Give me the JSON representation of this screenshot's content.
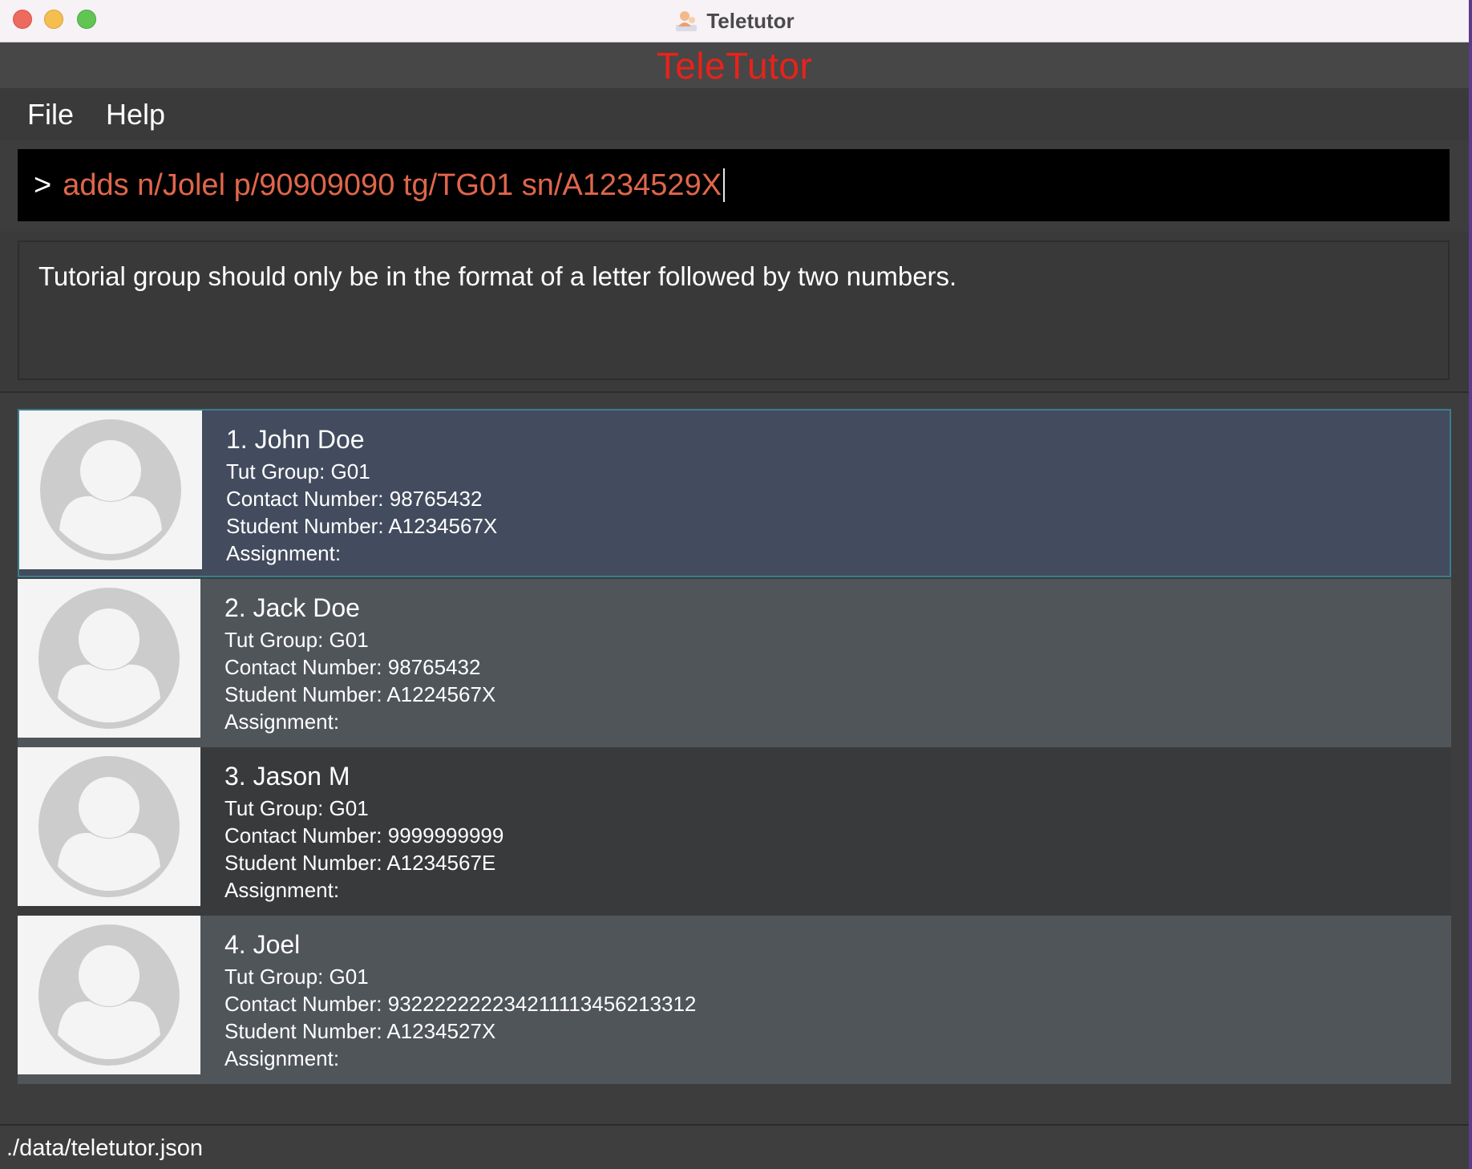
{
  "window": {
    "title": "Teletutor",
    "icon": "teletutor-app-icon"
  },
  "app": {
    "header_title": "TeleTutor",
    "header_color": "#e8221b"
  },
  "menu": {
    "items": [
      "File",
      "Help"
    ]
  },
  "command": {
    "prompt": ">",
    "value": "adds n/Jolel p/90909090 tg/TG01 sn/A1234529X",
    "text_color": "#e0664b"
  },
  "result": {
    "message": "Tutorial group should only be in the format of a letter followed by two numbers."
  },
  "persons": [
    {
      "name": "1. John Doe",
      "tut_group": "Tut Group: G01",
      "contact": "Contact Number: 98765432",
      "student_number": "Student Number: A1234567X",
      "assignment": "Assignment:",
      "selected": true
    },
    {
      "name": "2. Jack Doe",
      "tut_group": "Tut Group: G01",
      "contact": "Contact Number: 98765432",
      "student_number": "Student Number: A1224567X",
      "assignment": "Assignment:",
      "selected": false
    },
    {
      "name": "3. Jason M",
      "tut_group": "Tut Group: G01",
      "contact": "Contact Number: 9999999999",
      "student_number": "Student Number: A1234567E",
      "assignment": "Assignment:",
      "selected": false
    },
    {
      "name": "4. Joel",
      "tut_group": "Tut Group: G01",
      "contact": "Contact Number: 9322222222342111134562133​12",
      "student_number": "Student Number: A1234527X",
      "assignment": "Assignment:",
      "selected": false
    }
  ],
  "status": {
    "file_path": "./data/teletutor.json"
  }
}
